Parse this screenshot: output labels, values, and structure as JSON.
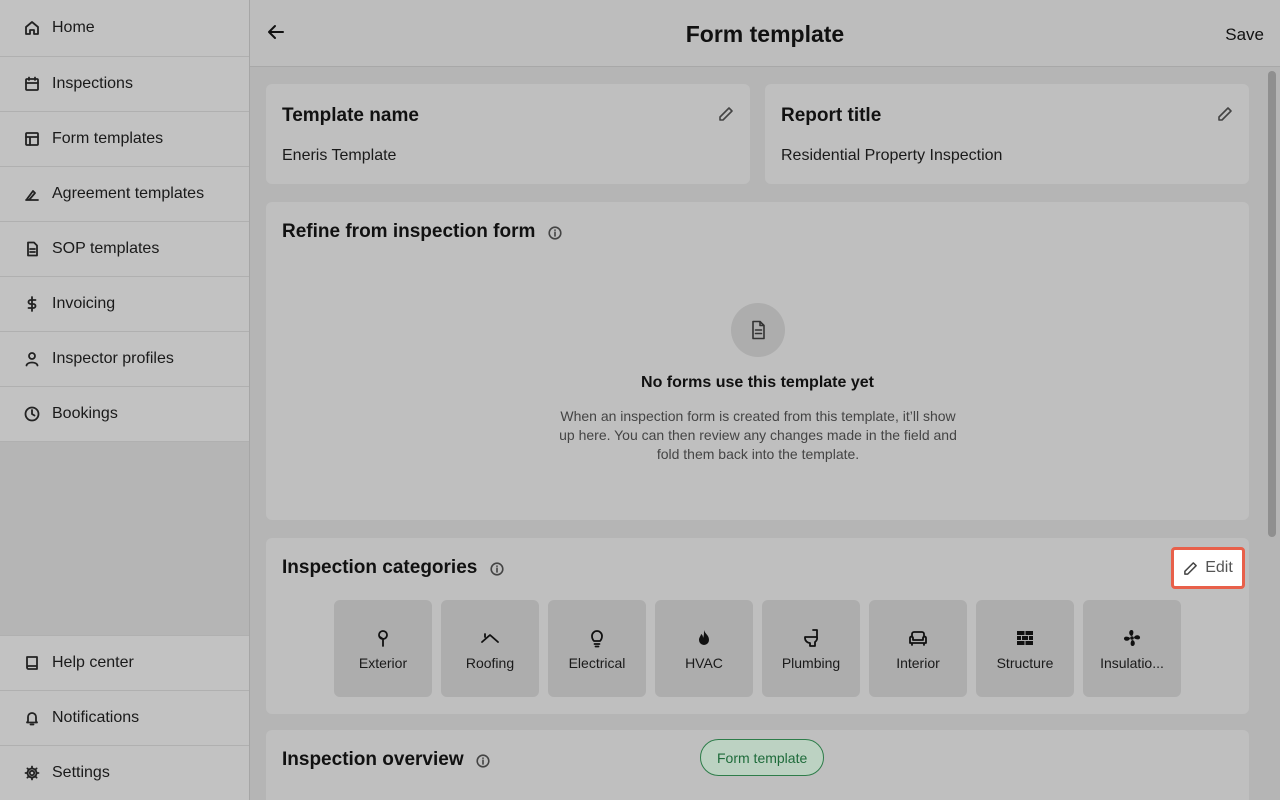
{
  "sidebar": {
    "top_items": [
      {
        "label": "Home",
        "icon": "home-icon"
      },
      {
        "label": "Inspections",
        "icon": "calendar-icon"
      },
      {
        "label": "Form templates",
        "icon": "layout-icon"
      },
      {
        "label": "Agreement templates",
        "icon": "signature-icon"
      },
      {
        "label": "SOP templates",
        "icon": "document-icon"
      },
      {
        "label": "Invoicing",
        "icon": "dollar-icon"
      },
      {
        "label": "Inspector profiles",
        "icon": "user-icon"
      },
      {
        "label": "Bookings",
        "icon": "clock-icon"
      }
    ],
    "bottom_items": [
      {
        "label": "Help center",
        "icon": "book-icon"
      },
      {
        "label": "Notifications",
        "icon": "bell-icon"
      },
      {
        "label": "Settings",
        "icon": "gear-icon"
      }
    ]
  },
  "header": {
    "title": "Form template",
    "save_label": "Save"
  },
  "template_name": {
    "label": "Template name",
    "value": "Eneris Template"
  },
  "report_title": {
    "label": "Report title",
    "value": "Residential Property Inspection"
  },
  "refine": {
    "title": "Refine from inspection form",
    "empty_title": "No forms use this template yet",
    "empty_desc": "When an inspection form is created from this template, it’ll show up here. You can then review any changes made in the field and fold them back into the template."
  },
  "categories": {
    "title": "Inspection categories",
    "edit_label": "Edit",
    "items": [
      {
        "label": "Exterior",
        "icon": "tree-icon"
      },
      {
        "label": "Roofing",
        "icon": "roof-icon"
      },
      {
        "label": "Electrical",
        "icon": "lightbulb-icon"
      },
      {
        "label": "HVAC",
        "icon": "flame-icon"
      },
      {
        "label": "Plumbing",
        "icon": "toilet-icon"
      },
      {
        "label": "Interior",
        "icon": "sofa-icon"
      },
      {
        "label": "Structure",
        "icon": "brick-icon"
      },
      {
        "label": "Insulatio...",
        "icon": "fan-icon"
      }
    ]
  },
  "overview": {
    "title": "Inspection overview",
    "badge": "Form template"
  },
  "colors": {
    "highlight": "#e8604a",
    "badge_green": "#2e7d4a"
  }
}
